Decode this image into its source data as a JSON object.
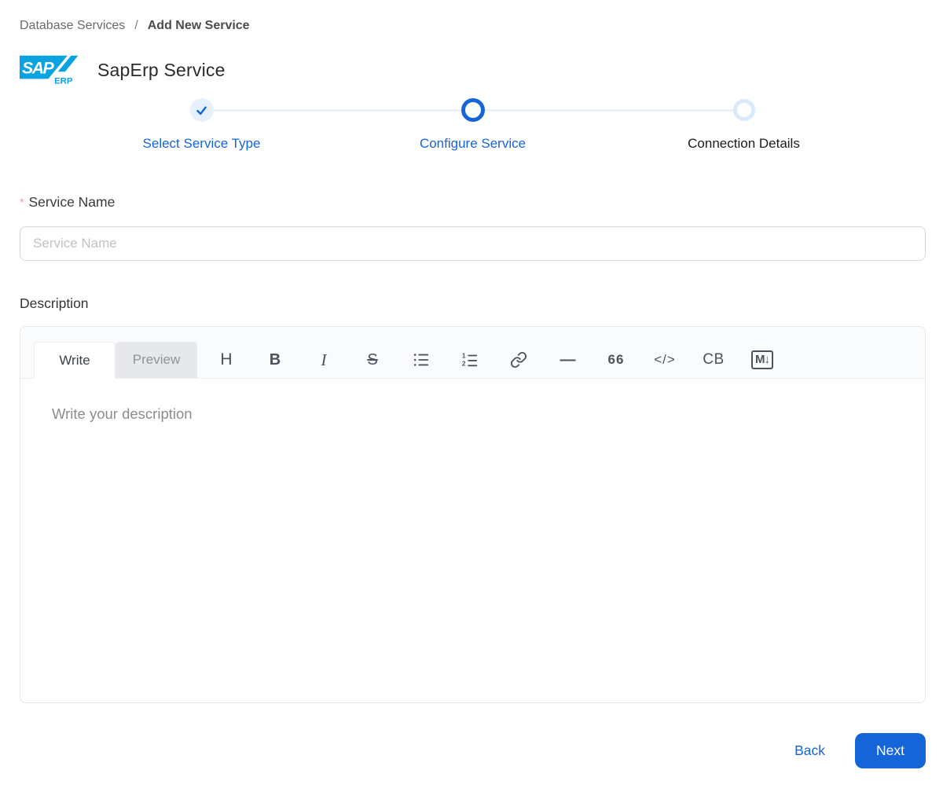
{
  "breadcrumb": {
    "parent": "Database Services",
    "separator": "/",
    "current": "Add New Service"
  },
  "header": {
    "logo": {
      "name": "sap-erp-logo",
      "main_text": "SAP",
      "sub_text": "ERP"
    },
    "title": "SapErp Service"
  },
  "stepper": {
    "steps": [
      {
        "label": "Select Service Type",
        "state": "completed"
      },
      {
        "label": "Configure Service",
        "state": "active"
      },
      {
        "label": "Connection Details",
        "state": "pending"
      }
    ]
  },
  "form": {
    "service_name": {
      "required_marker": "*",
      "label": "Service Name",
      "placeholder": "Service Name",
      "value": ""
    },
    "description": {
      "label": "Description",
      "placeholder": "Write your description",
      "value": ""
    }
  },
  "editor": {
    "tabs": [
      {
        "label": "Write",
        "active": true
      },
      {
        "label": "Preview",
        "active": false
      }
    ],
    "toolbar": [
      {
        "name": "heading",
        "glyph": "H"
      },
      {
        "name": "bold",
        "glyph": "B"
      },
      {
        "name": "italic",
        "glyph": "I"
      },
      {
        "name": "strikethrough",
        "glyph": "S"
      },
      {
        "name": "unordered-list"
      },
      {
        "name": "ordered-list"
      },
      {
        "name": "link"
      },
      {
        "name": "horizontal-rule",
        "glyph": "—"
      },
      {
        "name": "quote",
        "glyph": "66"
      },
      {
        "name": "code",
        "glyph": "</>"
      },
      {
        "name": "code-block",
        "glyph": "CB"
      },
      {
        "name": "markdown-guide",
        "glyph": "M↓"
      }
    ]
  },
  "actions": {
    "back_label": "Back",
    "next_label": "Next"
  },
  "colors": {
    "primary_blue": "#1565d8",
    "step_completed_fill": "#e6f1fd",
    "step_connector": "#e8f1fc",
    "step_pending_ring": "#d8eafc",
    "sap_logo_blue": "#0aa3e2",
    "required_marker": "#efa0a0",
    "next_button_bg": "#1565d8",
    "preview_tab_bg": "#e6e8eb"
  }
}
